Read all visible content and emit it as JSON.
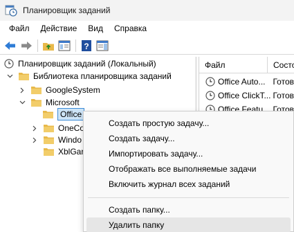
{
  "window": {
    "title": "Планировщик заданий"
  },
  "menu": [
    "Файл",
    "Действие",
    "Вид",
    "Справка"
  ],
  "toolbar": {
    "icons": [
      "back-arrow-icon",
      "forward-arrow-icon",
      "folder-up-icon",
      "console-tree-icon",
      "help-icon",
      "action-pane-icon"
    ]
  },
  "tree": {
    "root": "Планировщик заданий (Локальный)",
    "library": "Библиотека планировщика заданий",
    "google": "GoogleSystem",
    "microsoft": "Microsoft",
    "office": "Office",
    "onecore": "OneCo",
    "windows": "Windo",
    "xbl": "XblGar"
  },
  "list": {
    "columns": [
      "Файл",
      "Состо"
    ],
    "rows": [
      {
        "name": "Office Auto...",
        "status": "Готов"
      },
      {
        "name": "Office ClickT...",
        "status": "Готов"
      },
      {
        "name": "Office Featu...",
        "status": "Готов"
      }
    ]
  },
  "context_menu": {
    "items": [
      "Создать простую задачу...",
      "Создать задачу...",
      "Импортировать задачу...",
      "Отображать все выполняемые задачи",
      "Включить журнал всех заданий",
      "Создать папку...",
      "Удалить папку"
    ],
    "highlighted": "Удалить папку"
  },
  "colors": {
    "folder": "#e8b94a",
    "selection": "#cde4f7",
    "accent": "#2b6fc2"
  }
}
